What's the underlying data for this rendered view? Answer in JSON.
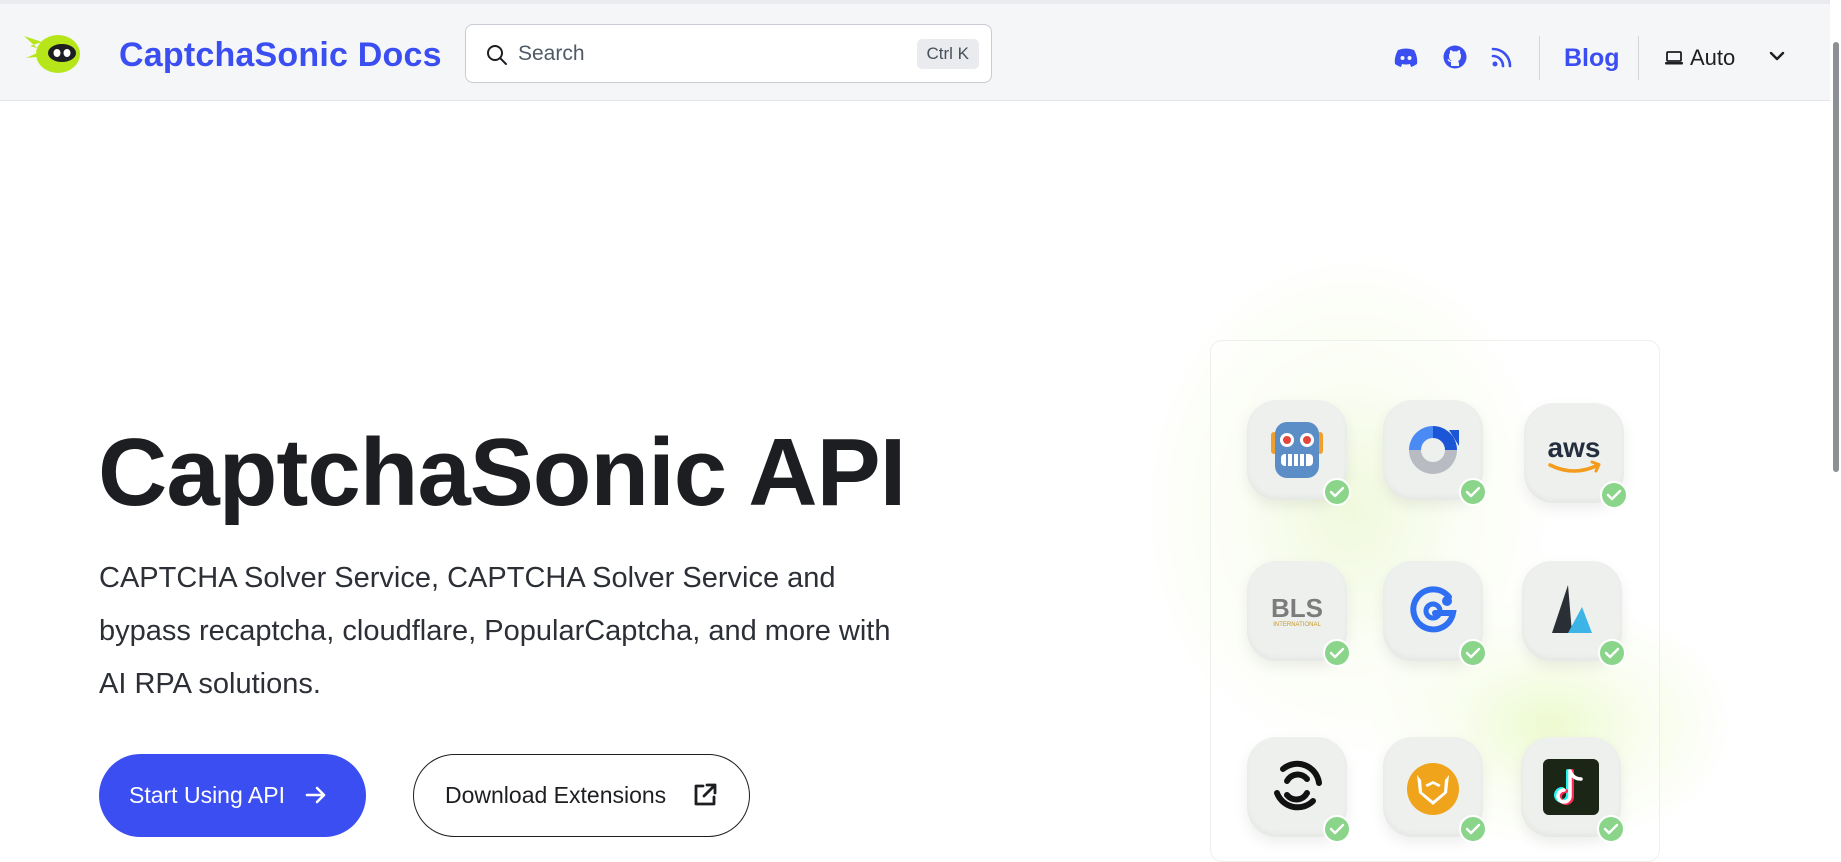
{
  "navbar": {
    "brand": "CaptchaSonic Docs",
    "search_placeholder": "Search",
    "search_shortcut": "Ctrl K",
    "blog_label": "Blog",
    "theme_label": "Auto",
    "icons": [
      "discord-icon",
      "github-icon",
      "rss-icon",
      "laptop-icon",
      "chevron-down-icon"
    ]
  },
  "hero": {
    "title": "CaptchaSonic API",
    "subtitle": "CAPTCHA Solver Service, CAPTCHA Solver Service and bypass recaptcha, cloudflare, PopularCaptcha, and more with AI RPA solutions.",
    "primary_button": "Start Using API",
    "secondary_button": "Download Extensions"
  },
  "tiles": {
    "aws_text": "aws",
    "bls_text": "BLS",
    "bls_sub": "INTERNATIONAL",
    "items": [
      "robot-logo-icon",
      "recaptcha-logo-icon",
      "aws-logo-icon",
      "bls-logo-icon",
      "geetest-logo-icon",
      "sail-logo-icon",
      "swirl-logo-icon",
      "fox-logo-icon",
      "tiktok-logo-icon"
    ],
    "status_icon": "check-icon"
  },
  "colors": {
    "accent": "#3b4ef2",
    "check": "#8bd58b",
    "navbar_bg": "#f5f6f7"
  }
}
